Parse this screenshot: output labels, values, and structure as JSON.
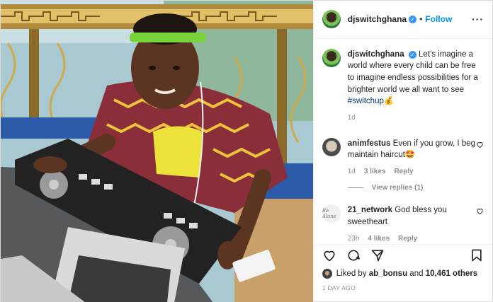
{
  "header": {
    "username": "djswitchghana",
    "verified_icon": "verified-badge-icon",
    "separator": "•",
    "follow_label": "Follow",
    "more_label": "···"
  },
  "caption": {
    "username": "djswitchghana",
    "text": "Let's imagine a world where every child can be free to imagine endless possibilities for a brighter world we all want to see",
    "hashtag": "#switchup",
    "emoji": "💰",
    "time": "1d"
  },
  "comments": [
    {
      "username": "animfestus",
      "text": "Even if you grow, I beg maintain haircut🤩",
      "time": "1d",
      "likes": "3 likes",
      "reply_label": "Reply",
      "view_replies": "View replies (1)"
    },
    {
      "username": "21_network",
      "avatar_text": "Be Alone",
      "text": "God bless you sweetheart",
      "time": "23h",
      "likes": "4 likes",
      "reply_label": "Reply"
    }
  ],
  "actions": {
    "icons": [
      "heart-icon",
      "comment-icon",
      "share-icon",
      "bookmark-icon"
    ]
  },
  "likes_summary": {
    "prefix": "Liked by",
    "user": "ab_bonsu",
    "middle": "and",
    "count": "10,461 others"
  },
  "date": "1 DAY AGO",
  "colors": {
    "accent": "#0095f6",
    "verified": "#3897f0",
    "muted": "#8e8e8e",
    "text": "#262626"
  }
}
